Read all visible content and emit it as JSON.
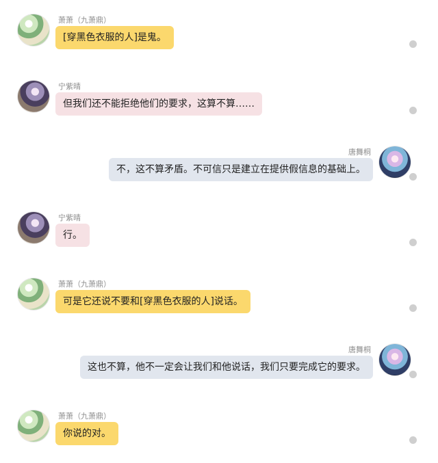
{
  "messages": [
    {
      "speaker": "萧萧（九萧鼎）",
      "text": "[穿黑色衣服的人]是鬼。"
    },
    {
      "speaker": "宁紫晴",
      "text": "但我们还不能拒绝他们的要求，这算不算……"
    },
    {
      "speaker": "唐舞桐",
      "text": "不，这不算矛盾。不可信只是建立在提供假信息的基础上。"
    },
    {
      "speaker": "宁紫晴",
      "text": "行。"
    },
    {
      "speaker": "萧萧（九萧鼎）",
      "text": "可是它还说不要和[穿黑色衣服的人]说话。"
    },
    {
      "speaker": "唐舞桐",
      "text": "这也不算，他不一定会让我们和他说话，我们只要完成它的要求。"
    },
    {
      "speaker": "萧萧（九萧鼎）",
      "text": "你说的对。"
    }
  ],
  "colors": {
    "left_yellow_bubble": "#fbd86d",
    "left_pink_bubble": "#f6e1e4",
    "right_gray_bubble": "#e1e6ee",
    "status_dot": "#cfcfcf"
  }
}
